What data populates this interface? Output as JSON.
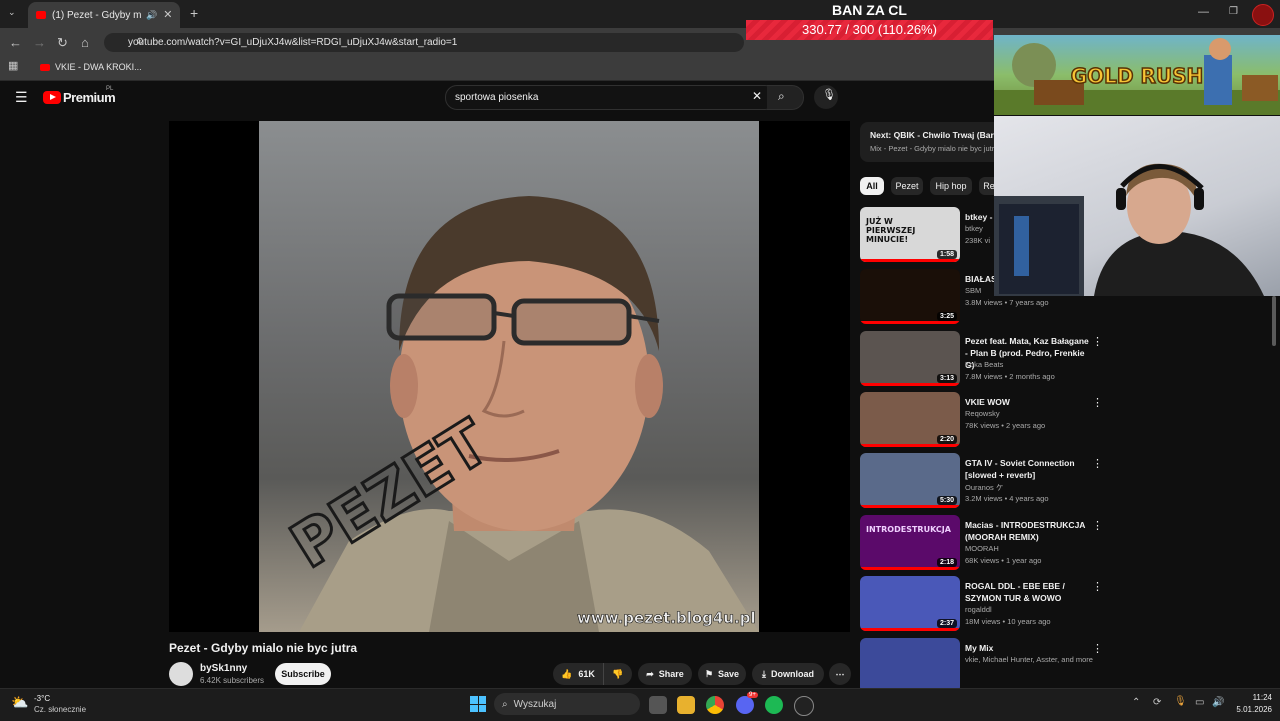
{
  "browser": {
    "tab_title": "(1) Pezet - Gdyby mialo nie",
    "url": "youtube.com/watch?v=GI_uDjuXJ4w&list=RDGI_uDjuXJ4w&start_radio=1",
    "bookmark": "VKIE - DWA KROKI..."
  },
  "youtube": {
    "logo_text": "Premium",
    "logo_region": "PL",
    "search_value": "sportowa piosenka"
  },
  "video": {
    "title": "Pezet - Gdyby mialo nie byc jutra",
    "watermark": "www.pezet.blog4u.pl",
    "graffiti": "PEZET",
    "channel": "bySk1nny",
    "subscribers": "6.42K subscribers",
    "subscribe_label": "Subscribe",
    "likes": "61K",
    "share_label": "Share",
    "save_label": "Save",
    "download_label": "Download"
  },
  "next": {
    "prefix": "Next:",
    "title": "QBIK - Chwilo Trwaj (Barti B",
    "mix": "Mix - Pezet - Gdyby mialo nie byc jutra"
  },
  "chips": [
    "All",
    "Pezet",
    "Hip hop",
    "Re"
  ],
  "related": [
    {
      "title": "btkey - BUNGE",
      "channel": "btkey",
      "meta": "238K vi",
      "duration": "1:58",
      "thumb_color": "#d8d8d8",
      "thumb_text": "JUŻ W PIERWSZEJ MINUCIE!"
    },
    {
      "title": "BIAŁAS DŁUGU",
      "channel": "SBM",
      "meta": "3.8M views • 7 years ago",
      "duration": "3:25",
      "thumb_color": "#1a0f08",
      "thumb_text": ""
    },
    {
      "title": "Pezet feat. Mata, Kaz Bałagane - Plan B (prod. Pedro, Frenkie G)",
      "channel": "Koka Beats",
      "meta": "7.8M views • 2 months ago",
      "duration": "3:13",
      "thumb_color": "#5b5450",
      "thumb_text": ""
    },
    {
      "title": "VKIE WOW",
      "channel": "Reqowsky",
      "meta": "78K views • 2 years ago",
      "duration": "2:20",
      "thumb_color": "#7b5b4a",
      "thumb_text": ""
    },
    {
      "title": "GTA IV - Soviet Connection [slowed + reverb]",
      "channel": "Ouranos ケ",
      "meta": "3.2M views • 4 years ago",
      "duration": "5:30",
      "thumb_color": "#5a6a8a",
      "thumb_text": ""
    },
    {
      "title": "Macias - INTRODESTRUKCJA (MOORAH REMIX)",
      "channel": "MOORAH",
      "meta": "68K views • 1 year ago",
      "duration": "2:18",
      "thumb_color": "#5b0a6a",
      "thumb_text": "INTRODESTRUKCJA"
    },
    {
      "title": "ROGAL DDL - EBE EBE / SZYMON TUR & WOWO",
      "channel": "rogalddl",
      "meta": "18M views • 10 years ago",
      "duration": "2:37",
      "thumb_color": "#4a58b8",
      "thumb_text": ""
    },
    {
      "title": "My Mix",
      "channel": "vkie, Michael Hunter, Asster, and more",
      "meta": "",
      "duration": "",
      "thumb_color": "#3c4a9a",
      "thumb_text": ""
    }
  ],
  "overlay": {
    "ban_title": "BAN ZA CL",
    "ban_progress": "330.77 / 300 (110.26%)",
    "game_title": "GOLD RUSH"
  },
  "taskbar": {
    "weather_temp": "-3°C",
    "weather_desc": "Cz. słonecznie",
    "search_placeholder": "Wyszukaj",
    "time": "11:24",
    "date": "5.01.2026",
    "discord_badge": "9+"
  }
}
